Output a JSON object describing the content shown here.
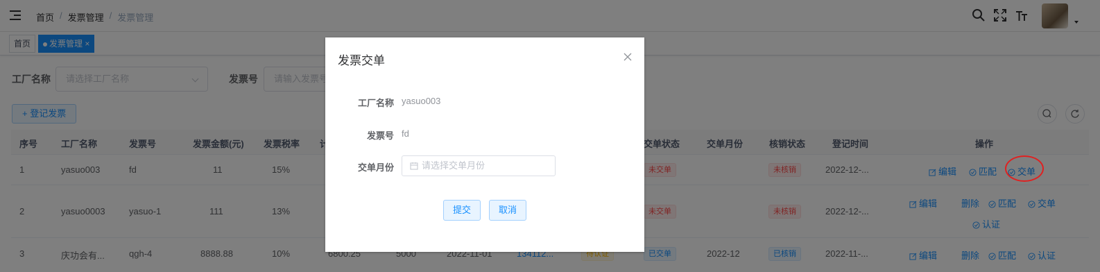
{
  "header": {
    "breadcrumb": [
      "首页",
      "发票管理",
      "发票管理"
    ],
    "separator": "/"
  },
  "tags": {
    "home": "首页",
    "active": "发票管理",
    "close": "×"
  },
  "filters": {
    "factory_label": "工厂名称",
    "factory_placeholder": "请选择工厂名称",
    "invoice_label": "发票号",
    "invoice_placeholder": "请输入发票号"
  },
  "toolbar": {
    "register_label": "+ 登记发票"
  },
  "table": {
    "headers": [
      "序号",
      "工厂名称",
      "发票号",
      "发票金额(元)",
      "发票税率",
      "计",
      "交单状态",
      "交单月份",
      "核销状态",
      "登记时间",
      "操作"
    ],
    "rows": [
      {
        "index": "1",
        "factory": "yasuo003",
        "invoice_no": "fd",
        "amount": "11",
        "tax_rate": "15%",
        "submit_status": "未交单",
        "month": "",
        "verify_status": "未核销",
        "reg_time": "2022-12-...",
        "ops": [
          "编辑",
          "匹配",
          "交单"
        ]
      },
      {
        "index": "2",
        "factory": "yasuo0003",
        "invoice_no": "yasuo-1",
        "amount": "111",
        "tax_rate": "13%",
        "submit_status": "未交单",
        "month": "",
        "verify_status": "未核销",
        "reg_time": "2022-12-...",
        "ops": [
          "编辑",
          "删除",
          "匹配",
          "交单",
          "认证"
        ]
      },
      {
        "index": "3",
        "factory": "庆功会有...",
        "invoice_no": "qgh-4",
        "amount": "8888.88",
        "tax_rate": "10%",
        "col6": "6800.25",
        "col7": "5000",
        "col8": "2022-11-01",
        "col9": "134112...",
        "col10": "待认证",
        "submit_status": "已交单",
        "month": "2022-12",
        "verify_status": "已核销",
        "reg_time": "2022-11-...",
        "ops": [
          "编辑",
          "删除",
          "匹配",
          "认证"
        ]
      }
    ]
  },
  "dialog": {
    "title": "发票交单",
    "factory_label": "工厂名称",
    "factory_value": "yasuo003",
    "invoice_label": "发票号",
    "invoice_value": "fd",
    "month_label": "交单月份",
    "month_placeholder": "请选择交单月份",
    "submit_label": "提交",
    "cancel_label": "取消"
  },
  "colors": {
    "primary": "#1890ff",
    "danger": "#ff4949",
    "annotation": "#e02020"
  }
}
